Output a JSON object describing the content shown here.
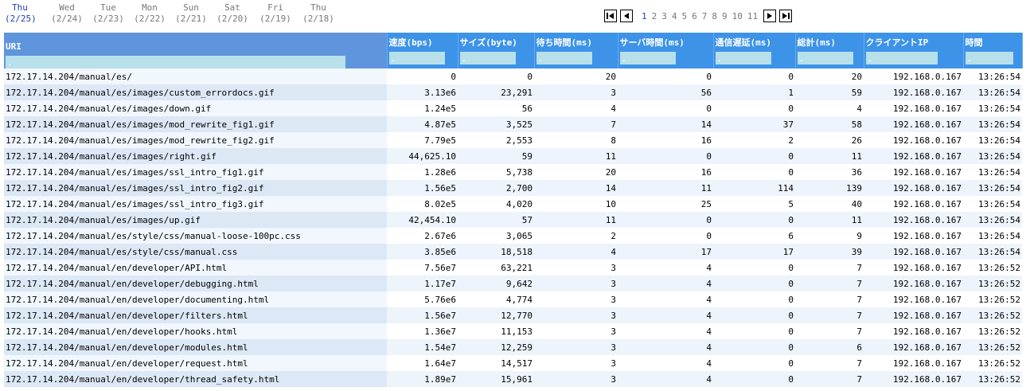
{
  "days": [
    {
      "name": "Thu",
      "date": "(2/25)",
      "active": true
    },
    {
      "name": "Wed",
      "date": "(2/24)"
    },
    {
      "name": "Tue",
      "date": "(2/23)"
    },
    {
      "name": "Mon",
      "date": "(2/22)"
    },
    {
      "name": "Sun",
      "date": "(2/21)"
    },
    {
      "name": "Sat",
      "date": "(2/20)"
    },
    {
      "name": "Fri",
      "date": "(2/19)"
    },
    {
      "name": "Thu",
      "date": "(2/18)"
    }
  ],
  "pager": {
    "first_icon": "first-page-icon",
    "prev_icon": "prev-page-icon",
    "next_icon": "next-page-icon",
    "last_icon": "last-page-icon",
    "pages": [
      "1",
      "2",
      "3",
      "4",
      "5",
      "6",
      "7",
      "8",
      "9",
      "10",
      "11"
    ],
    "current": "1"
  },
  "colors": {
    "header": "#3d93e8",
    "uri_header": "#5f95dd",
    "filter": "#b7e0ea",
    "link": "#1f3fb0"
  },
  "table": {
    "columns": [
      "URI",
      "速度(bps)",
      "サイズ(byte)",
      "待ち時間(ms)",
      "サーバ時間(ms)",
      "通信遅延(ms)",
      "総計(ms)",
      "クライアントIP",
      "時間"
    ],
    "filters": [
      ".",
      ".",
      ".",
      ".",
      ".",
      ".",
      ".",
      ".",
      "."
    ],
    "rows": [
      [
        "172.17.14.204/manual/es/",
        "0",
        "0",
        "20",
        "0",
        "0",
        "20",
        "192.168.0.167",
        "13:26:54"
      ],
      [
        "172.17.14.204/manual/es/images/custom_errordocs.gif",
        "3.13e6",
        "23,291",
        "3",
        "56",
        "1",
        "59",
        "192.168.0.167",
        "13:26:54"
      ],
      [
        "172.17.14.204/manual/es/images/down.gif",
        "1.24e5",
        "56",
        "4",
        "0",
        "0",
        "4",
        "192.168.0.167",
        "13:26:54"
      ],
      [
        "172.17.14.204/manual/es/images/mod_rewrite_fig1.gif",
        "4.87e5",
        "3,525",
        "7",
        "14",
        "37",
        "58",
        "192.168.0.167",
        "13:26:54"
      ],
      [
        "172.17.14.204/manual/es/images/mod_rewrite_fig2.gif",
        "7.79e5",
        "2,553",
        "8",
        "16",
        "2",
        "26",
        "192.168.0.167",
        "13:26:54"
      ],
      [
        "172.17.14.204/manual/es/images/right.gif",
        "44,625.10",
        "59",
        "11",
        "0",
        "0",
        "11",
        "192.168.0.167",
        "13:26:54"
      ],
      [
        "172.17.14.204/manual/es/images/ssl_intro_fig1.gif",
        "1.28e6",
        "5,738",
        "20",
        "16",
        "0",
        "36",
        "192.168.0.167",
        "13:26:54"
      ],
      [
        "172.17.14.204/manual/es/images/ssl_intro_fig2.gif",
        "1.56e5",
        "2,700",
        "14",
        "11",
        "114",
        "139",
        "192.168.0.167",
        "13:26:54"
      ],
      [
        "172.17.14.204/manual/es/images/ssl_intro_fig3.gif",
        "8.02e5",
        "4,020",
        "10",
        "25",
        "5",
        "40",
        "192.168.0.167",
        "13:26:54"
      ],
      [
        "172.17.14.204/manual/es/images/up.gif",
        "42,454.10",
        "57",
        "11",
        "0",
        "0",
        "11",
        "192.168.0.167",
        "13:26:54"
      ],
      [
        "172.17.14.204/manual/es/style/css/manual-loose-100pc.css",
        "2.67e6",
        "3,065",
        "2",
        "0",
        "6",
        "9",
        "192.168.0.167",
        "13:26:54"
      ],
      [
        "172.17.14.204/manual/es/style/css/manual.css",
        "3.85e6",
        "18,518",
        "4",
        "17",
        "17",
        "39",
        "192.168.0.167",
        "13:26:54"
      ],
      [
        "172.17.14.204/manual/en/developer/API.html",
        "7.56e7",
        "63,221",
        "3",
        "4",
        "0",
        "7",
        "192.168.0.167",
        "13:26:52"
      ],
      [
        "172.17.14.204/manual/en/developer/debugging.html",
        "1.17e7",
        "9,642",
        "3",
        "4",
        "0",
        "7",
        "192.168.0.167",
        "13:26:52"
      ],
      [
        "172.17.14.204/manual/en/developer/documenting.html",
        "5.76e6",
        "4,774",
        "3",
        "4",
        "0",
        "7",
        "192.168.0.167",
        "13:26:52"
      ],
      [
        "172.17.14.204/manual/en/developer/filters.html",
        "1.56e7",
        "12,770",
        "3",
        "4",
        "0",
        "7",
        "192.168.0.167",
        "13:26:52"
      ],
      [
        "172.17.14.204/manual/en/developer/hooks.html",
        "1.36e7",
        "11,153",
        "3",
        "4",
        "0",
        "7",
        "192.168.0.167",
        "13:26:52"
      ],
      [
        "172.17.14.204/manual/en/developer/modules.html",
        "1.54e7",
        "12,259",
        "3",
        "4",
        "0",
        "6",
        "192.168.0.167",
        "13:26:52"
      ],
      [
        "172.17.14.204/manual/en/developer/request.html",
        "1.64e7",
        "14,517",
        "3",
        "4",
        "0",
        "7",
        "192.168.0.167",
        "13:26:52"
      ],
      [
        "172.17.14.204/manual/en/developer/thread_safety.html",
        "1.89e7",
        "15,961",
        "3",
        "4",
        "0",
        "7",
        "192.168.0.167",
        "13:26:52"
      ]
    ]
  }
}
